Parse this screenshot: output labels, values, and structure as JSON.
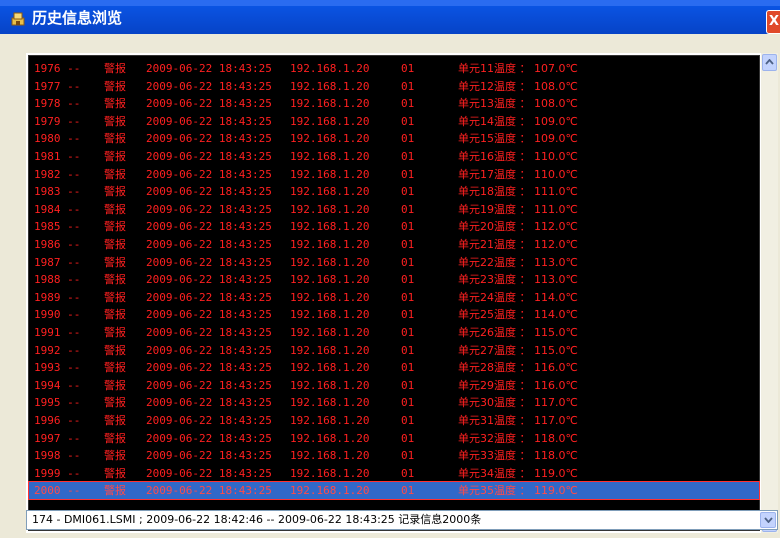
{
  "window": {
    "title": "历史信息浏览",
    "close_glyph": "X"
  },
  "log": {
    "rows": [
      {
        "id": "1976 --",
        "type": "警报",
        "time": "2009-06-22 18:43:25",
        "ip": "192.168.1.20",
        "channel": "01",
        "message": "单元11温度 ： 107.0℃"
      },
      {
        "id": "1977 --",
        "type": "警报",
        "time": "2009-06-22 18:43:25",
        "ip": "192.168.1.20",
        "channel": "01",
        "message": "单元12温度 ： 108.0℃"
      },
      {
        "id": "1978 --",
        "type": "警报",
        "time": "2009-06-22 18:43:25",
        "ip": "192.168.1.20",
        "channel": "01",
        "message": "单元13温度 ： 108.0℃"
      },
      {
        "id": "1979 --",
        "type": "警报",
        "time": "2009-06-22 18:43:25",
        "ip": "192.168.1.20",
        "channel": "01",
        "message": "单元14温度 ： 109.0℃"
      },
      {
        "id": "1980 --",
        "type": "警报",
        "time": "2009-06-22 18:43:25",
        "ip": "192.168.1.20",
        "channel": "01",
        "message": "单元15温度 ： 109.0℃"
      },
      {
        "id": "1981 --",
        "type": "警报",
        "time": "2009-06-22 18:43:25",
        "ip": "192.168.1.20",
        "channel": "01",
        "message": "单元16温度 ： 110.0℃"
      },
      {
        "id": "1982 --",
        "type": "警报",
        "time": "2009-06-22 18:43:25",
        "ip": "192.168.1.20",
        "channel": "01",
        "message": "单元17温度 ： 110.0℃"
      },
      {
        "id": "1983 --",
        "type": "警报",
        "time": "2009-06-22 18:43:25",
        "ip": "192.168.1.20",
        "channel": "01",
        "message": "单元18温度 ： 111.0℃"
      },
      {
        "id": "1984 --",
        "type": "警报",
        "time": "2009-06-22 18:43:25",
        "ip": "192.168.1.20",
        "channel": "01",
        "message": "单元19温度 ： 111.0℃"
      },
      {
        "id": "1985 --",
        "type": "警报",
        "time": "2009-06-22 18:43:25",
        "ip": "192.168.1.20",
        "channel": "01",
        "message": "单元20温度 ： 112.0℃"
      },
      {
        "id": "1986 --",
        "type": "警报",
        "time": "2009-06-22 18:43:25",
        "ip": "192.168.1.20",
        "channel": "01",
        "message": "单元21温度 ： 112.0℃"
      },
      {
        "id": "1987 --",
        "type": "警报",
        "time": "2009-06-22 18:43:25",
        "ip": "192.168.1.20",
        "channel": "01",
        "message": "单元22温度 ： 113.0℃"
      },
      {
        "id": "1988 --",
        "type": "警报",
        "time": "2009-06-22 18:43:25",
        "ip": "192.168.1.20",
        "channel": "01",
        "message": "单元23温度 ： 113.0℃"
      },
      {
        "id": "1989 --",
        "type": "警报",
        "time": "2009-06-22 18:43:25",
        "ip": "192.168.1.20",
        "channel": "01",
        "message": "单元24温度 ： 114.0℃"
      },
      {
        "id": "1990 --",
        "type": "警报",
        "time": "2009-06-22 18:43:25",
        "ip": "192.168.1.20",
        "channel": "01",
        "message": "单元25温度 ： 114.0℃"
      },
      {
        "id": "1991 --",
        "type": "警报",
        "time": "2009-06-22 18:43:25",
        "ip": "192.168.1.20",
        "channel": "01",
        "message": "单元26温度 ： 115.0℃"
      },
      {
        "id": "1992 --",
        "type": "警报",
        "time": "2009-06-22 18:43:25",
        "ip": "192.168.1.20",
        "channel": "01",
        "message": "单元27温度 ： 115.0℃"
      },
      {
        "id": "1993 --",
        "type": "警报",
        "time": "2009-06-22 18:43:25",
        "ip": "192.168.1.20",
        "channel": "01",
        "message": "单元28温度 ： 116.0℃"
      },
      {
        "id": "1994 --",
        "type": "警报",
        "time": "2009-06-22 18:43:25",
        "ip": "192.168.1.20",
        "channel": "01",
        "message": "单元29温度 ： 116.0℃"
      },
      {
        "id": "1995 --",
        "type": "警报",
        "time": "2009-06-22 18:43:25",
        "ip": "192.168.1.20",
        "channel": "01",
        "message": "单元30温度 ： 117.0℃"
      },
      {
        "id": "1996 --",
        "type": "警报",
        "time": "2009-06-22 18:43:25",
        "ip": "192.168.1.20",
        "channel": "01",
        "message": "单元31温度 ： 117.0℃"
      },
      {
        "id": "1997 --",
        "type": "警报",
        "time": "2009-06-22 18:43:25",
        "ip": "192.168.1.20",
        "channel": "01",
        "message": "单元32温度 ： 118.0℃"
      },
      {
        "id": "1998 --",
        "type": "警报",
        "time": "2009-06-22 18:43:25",
        "ip": "192.168.1.20",
        "channel": "01",
        "message": "单元33温度 ： 118.0℃"
      },
      {
        "id": "1999 --",
        "type": "警报",
        "time": "2009-06-22 18:43:25",
        "ip": "192.168.1.20",
        "channel": "01",
        "message": "单元34温度 ： 119.0℃"
      },
      {
        "id": "2000 --",
        "type": "警报",
        "time": "2009-06-22 18:43:25",
        "ip": "192.168.1.20",
        "channel": "01",
        "message": "单元35温度 ： 119.0℃"
      }
    ],
    "selected_index": 24,
    "text_color": "#ff2020",
    "background": "#000000",
    "selection_color": "#3168c8"
  },
  "status": {
    "text": "174 - DMI061.LSMI ; 2009-06-22 18:42:46 -- 2009-06-22 18:43:25   记录信息2000条",
    "dropdown_icon": "chevron-down-icon"
  },
  "scrollbar": {
    "up_icon": "chevron-up-icon",
    "down_icon": "chevron-down-icon"
  }
}
